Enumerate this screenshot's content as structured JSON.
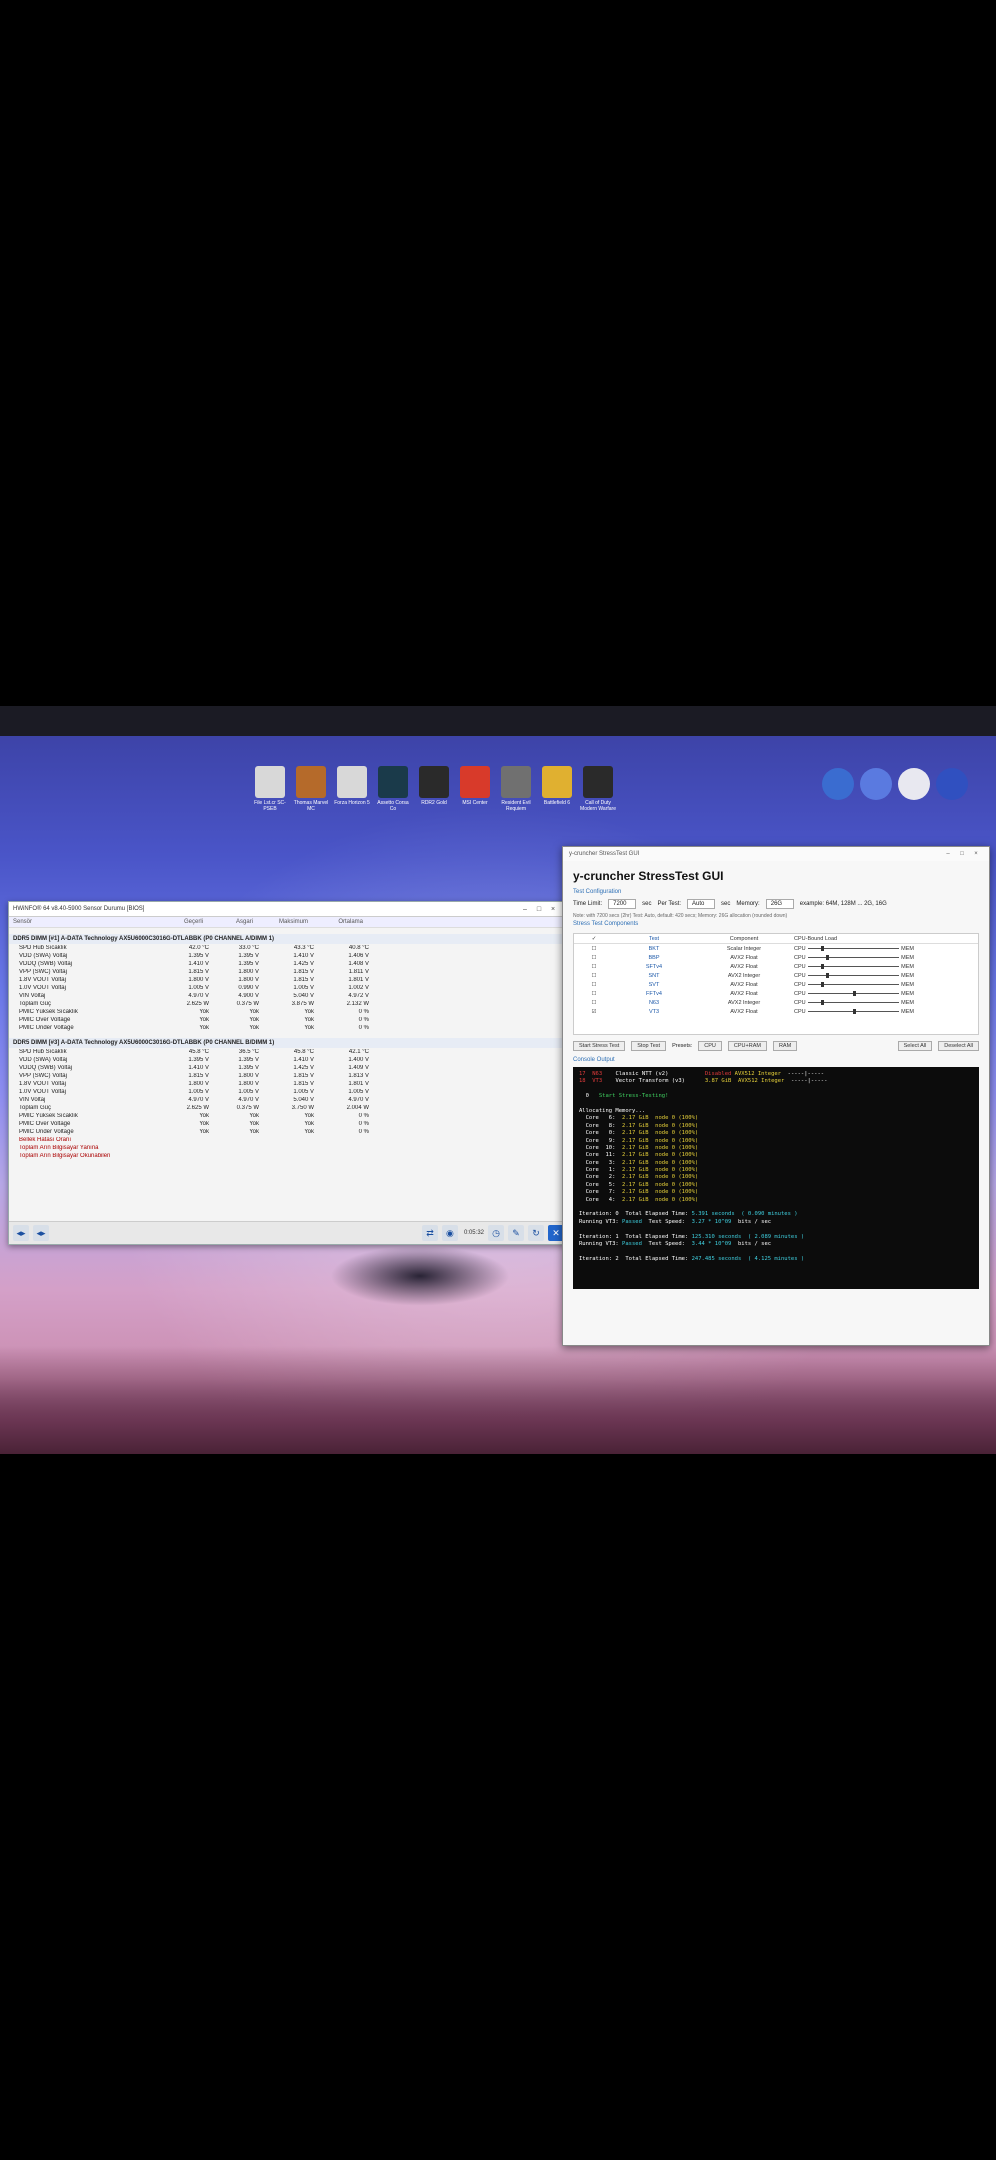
{
  "desktop": {
    "icons": [
      {
        "label": "File Lst.cr SC-PSEB",
        "color": "#d8d8d8"
      },
      {
        "label": "Thomas Marvel MC",
        "color": "#b56a2a"
      },
      {
        "label": "Forza Horizon 5",
        "color": "#d8d8d8"
      },
      {
        "label": "Assetto Corsa Co",
        "color": "#1a3a4a"
      },
      {
        "label": "RDR2 Gold",
        "color": "#2a2a2a"
      },
      {
        "label": "MSI Center",
        "color": "#d83a2a"
      },
      {
        "label": "Resident Evil Requiem",
        "color": "#707070"
      },
      {
        "label": "Battlefield 6",
        "color": "#e0b030"
      },
      {
        "label": "Call of Duty Modern Warfare",
        "color": "#2a2a2a"
      }
    ],
    "right_icons": [
      {
        "name": "playnite-icon",
        "color": "#3a6cd0"
      },
      {
        "name": "ps-remote-icon",
        "color": "#5a7ae0"
      },
      {
        "name": "ubisoft-icon",
        "color": "#e8e8f0"
      },
      {
        "name": "ea-icon",
        "color": "#3050c0"
      }
    ]
  },
  "hwinfo": {
    "title": "HWiNFO® 64 v8.40-5900 Sensor Durumu [BIOS]",
    "window_buttons": [
      "–",
      "□",
      "×"
    ],
    "columns": [
      "Sensör",
      "Geçerli",
      "Asgari",
      "Maksimum",
      "Ortalama"
    ],
    "sections": [
      {
        "title": "DDR5 DIMM [#1] A-DATA Technology AX5U6000C3016G-DTLABBK (P0 CHANNEL A/DIMM 1)",
        "rows": [
          [
            "SPD Hub Sıcaklık",
            "42.0 °C",
            "33.0 °C",
            "43.3 °C",
            "40.8 °C"
          ],
          [
            "VDD (SWA) Voltaj",
            "1.395 V",
            "1.395 V",
            "1.410 V",
            "1.406 V"
          ],
          [
            "VDDQ (SWB) Voltaj",
            "1.410 V",
            "1.395 V",
            "1.425 V",
            "1.408 V"
          ],
          [
            "VPP (SWC) Voltaj",
            "1.815 V",
            "1.800 V",
            "1.815 V",
            "1.811 V"
          ],
          [
            "1.8V VOUT Voltaj",
            "1.800 V",
            "1.800 V",
            "1.815 V",
            "1.801 V"
          ],
          [
            "1.0V VOUT Voltaj",
            "1.005 V",
            "0.990 V",
            "1.005 V",
            "1.002 V"
          ],
          [
            "VIN Voltaj",
            "4.970 V",
            "4.900 V",
            "5.040 V",
            "4.972 V"
          ],
          [
            "Toplam Güç",
            "2.625 W",
            "0.375 W",
            "3.875 W",
            "2.132 W"
          ],
          [
            "PMIC Yüksek Sıcaklık",
            "Yok",
            "Yok",
            "Yok",
            "0 %"
          ],
          [
            "PMIC Over Voltage",
            "Yok",
            "Yok",
            "Yok",
            "0 %"
          ],
          [
            "PMIC Under Voltage",
            "Yok",
            "Yok",
            "Yok",
            "0 %"
          ]
        ]
      },
      {
        "title": "DDR5 DIMM [#3] A-DATA Technology AX5U6000C3016G-DTLABBK (P0 CHANNEL B/DIMM 1)",
        "rows": [
          [
            "SPD Hub Sıcaklık",
            "45.8 °C",
            "36.5 °C",
            "45.8 °C",
            "42.1 °C"
          ],
          [
            "VDD (SWA) Voltaj",
            "1.395 V",
            "1.395 V",
            "1.410 V",
            "1.400 V"
          ],
          [
            "VDDQ (SWB) Voltaj",
            "1.410 V",
            "1.395 V",
            "1.425 V",
            "1.409 V"
          ],
          [
            "VPP (SWC) Voltaj",
            "1.815 V",
            "1.800 V",
            "1.815 V",
            "1.813 V"
          ],
          [
            "1.8V VOUT Voltaj",
            "1.800 V",
            "1.800 V",
            "1.815 V",
            "1.801 V"
          ],
          [
            "1.0V VOUT Voltaj",
            "1.005 V",
            "1.005 V",
            "1.005 V",
            "1.005 V"
          ],
          [
            "VIN Voltaj",
            "4.970 V",
            "4.970 V",
            "5.040 V",
            "4.970 V"
          ],
          [
            "Toplam Güç",
            "2.625 W",
            "0.375 W",
            "3.750 W",
            "2.004 W"
          ],
          [
            "PMIC Yüksek Sıcaklık",
            "Yok",
            "Yok",
            "Yok",
            "0 %"
          ],
          [
            "PMIC Over Voltage",
            "Yok",
            "Yok",
            "Yok",
            "0 %"
          ],
          [
            "PMIC Under Voltage",
            "Yok",
            "Yok",
            "Yok",
            "0 %"
          ]
        ],
        "warnings": [
          "Bellek Hatası Oranı",
          "Toplam Arın Bilgisayar Yanına",
          "Toplam Arın Bilgisayar Okunabilen"
        ]
      }
    ],
    "footer": {
      "clock": "0:05:32"
    }
  },
  "ycruncher": {
    "title": "y-cruncher StressTest GUI",
    "heading": "y-cruncher StressTest GUI",
    "config_label": "Test Configuration",
    "time_limit_label": "Time Limit:",
    "time_limit": "7200",
    "time_unit": "sec",
    "per_test_label": "Per Test:",
    "per_test": "Auto",
    "memory_label": "Memory:",
    "memory": "26G",
    "memory_note": "example: 64M, 128M ... 2G, 16G",
    "note": "Note: with 7200 secs (2hr) Test: Auto, default: 420 secs; Memory: 26G allocation (rounded down)",
    "components_label": "Stress Test Components",
    "grid_headers": [
      "✓",
      "Test",
      "Component",
      "CPU-Bound Load"
    ],
    "tests": [
      {
        "check": "☐",
        "name": "BKT",
        "component": "Scalar Integer"
      },
      {
        "check": "☐",
        "name": "BBP",
        "component": "AVX2 Float"
      },
      {
        "check": "☐",
        "name": "SFTv4",
        "component": "AVX2 Float"
      },
      {
        "check": "☐",
        "name": "SNT",
        "component": "AVX2 Integer"
      },
      {
        "check": "☐",
        "name": "SVT",
        "component": "AVX2 Float"
      },
      {
        "check": "☐",
        "name": "FFTv4",
        "component": "AVX2 Float"
      },
      {
        "check": "☐",
        "name": "N63",
        "component": "AVX2 Integer"
      },
      {
        "check": "☑",
        "name": "VT3",
        "component": "AVX2 Float"
      }
    ],
    "cpu_label": "CPU",
    "mem_label": "MEM",
    "buttons": {
      "start": "Start Stress Test",
      "stop": "Stop Test",
      "presets": "Presets:",
      "p_cpu": "CPU",
      "p_cpumem": "CPU+RAM",
      "p_ram": "RAM",
      "select_all": "Select All",
      "deselect_all": "Deselect All"
    },
    "console_label": "Console Output",
    "console": [
      {
        "cls": "",
        "segs": [
          [
            "r",
            "17  N63    "
          ],
          [
            "w",
            "Classic NTT (v2)           "
          ],
          [
            "r",
            "Disabled "
          ],
          [
            "y",
            "AVX512 Integer"
          ],
          [
            "w",
            "  -----|-----"
          ]
        ]
      },
      {
        "cls": "",
        "segs": [
          [
            "r",
            "18  VT3    "
          ],
          [
            "w",
            "Vector Transform (v3)      "
          ],
          [
            "y",
            "3.87 GiB  AVX512 Integer"
          ],
          [
            "w",
            "  -----|-----"
          ]
        ]
      },
      {
        "cls": "",
        "segs": [
          [
            "w",
            " "
          ]
        ]
      },
      {
        "cls": "",
        "segs": [
          [
            "w",
            "  0   "
          ],
          [
            "g",
            "Start Stress-Testing!"
          ]
        ]
      },
      {
        "cls": "",
        "segs": [
          [
            "w",
            " "
          ]
        ]
      },
      {
        "cls": "",
        "segs": [
          [
            "w",
            "Allocating Memory..."
          ]
        ]
      },
      {
        "cls": "",
        "segs": [
          [
            "w",
            "  Core   6:  "
          ],
          [
            "y",
            "2.17 GiB  node 0 (100%)"
          ]
        ]
      },
      {
        "cls": "",
        "segs": [
          [
            "w",
            "  Core   8:  "
          ],
          [
            "y",
            "2.17 GiB  node 0 (100%)"
          ]
        ]
      },
      {
        "cls": "",
        "segs": [
          [
            "w",
            "  Core   0:  "
          ],
          [
            "y",
            "2.17 GiB  node 0 (100%)"
          ]
        ]
      },
      {
        "cls": "",
        "segs": [
          [
            "w",
            "  Core   9:  "
          ],
          [
            "y",
            "2.17 GiB  node 0 (100%)"
          ]
        ]
      },
      {
        "cls": "",
        "segs": [
          [
            "w",
            "  Core  10:  "
          ],
          [
            "y",
            "2.17 GiB  node 0 (100%)"
          ]
        ]
      },
      {
        "cls": "",
        "segs": [
          [
            "w",
            "  Core  11:  "
          ],
          [
            "y",
            "2.17 GiB  node 0 (100%)"
          ]
        ]
      },
      {
        "cls": "",
        "segs": [
          [
            "w",
            "  Core   3:  "
          ],
          [
            "y",
            "2.17 GiB  node 0 (100%)"
          ]
        ]
      },
      {
        "cls": "",
        "segs": [
          [
            "w",
            "  Core   1:  "
          ],
          [
            "y",
            "2.17 GiB  node 0 (100%)"
          ]
        ]
      },
      {
        "cls": "",
        "segs": [
          [
            "w",
            "  Core   2:  "
          ],
          [
            "y",
            "2.17 GiB  node 0 (100%)"
          ]
        ]
      },
      {
        "cls": "",
        "segs": [
          [
            "w",
            "  Core   5:  "
          ],
          [
            "y",
            "2.17 GiB  node 0 (100%)"
          ]
        ]
      },
      {
        "cls": "",
        "segs": [
          [
            "w",
            "  Core   7:  "
          ],
          [
            "y",
            "2.17 GiB  node 0 (100%)"
          ]
        ]
      },
      {
        "cls": "",
        "segs": [
          [
            "w",
            "  Core   4:  "
          ],
          [
            "y",
            "2.17 GiB  node 0 (100%)"
          ]
        ]
      },
      {
        "cls": "",
        "segs": [
          [
            "w",
            " "
          ]
        ]
      },
      {
        "cls": "",
        "segs": [
          [
            "w",
            "Iteration: 0  Total Elapsed Time: "
          ],
          [
            "cy",
            "5.391 seconds  ( 0.090 minutes )"
          ]
        ]
      },
      {
        "cls": "",
        "segs": [
          [
            "w",
            "Running VT3: "
          ],
          [
            "cy",
            "Passed"
          ],
          [
            "w",
            "  Test Speed:  "
          ],
          [
            "cy",
            "3.27 * 10^09"
          ],
          [
            "w",
            "  bits / sec"
          ]
        ]
      },
      {
        "cls": "",
        "segs": [
          [
            "w",
            " "
          ]
        ]
      },
      {
        "cls": "",
        "segs": [
          [
            "w",
            "Iteration: 1  Total Elapsed Time: "
          ],
          [
            "cy",
            "125.310 seconds  ( 2.089 minutes )"
          ]
        ]
      },
      {
        "cls": "",
        "segs": [
          [
            "w",
            "Running VT3: "
          ],
          [
            "cy",
            "Passed"
          ],
          [
            "w",
            "  Test Speed:  "
          ],
          [
            "cy",
            "3.44 * 10^09"
          ],
          [
            "w",
            "  bits / sec"
          ]
        ]
      },
      {
        "cls": "",
        "segs": [
          [
            "w",
            " "
          ]
        ]
      },
      {
        "cls": "",
        "segs": [
          [
            "w",
            "Iteration: 2  Total Elapsed Time: "
          ],
          [
            "cy",
            "247.485 seconds  ( 4.125 minutes )"
          ]
        ]
      }
    ]
  }
}
